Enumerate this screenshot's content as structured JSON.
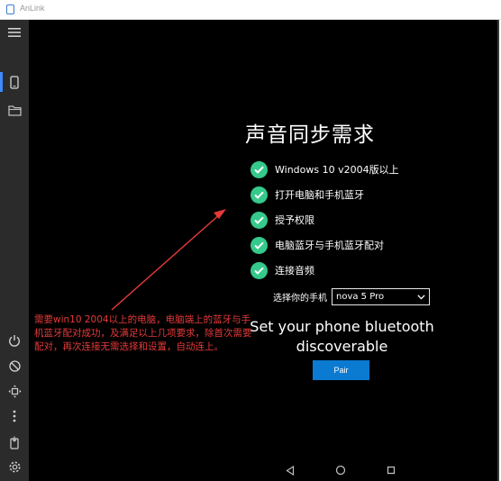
{
  "window": {
    "title": "AnLink"
  },
  "sidebar": {
    "top_items": [
      {
        "icon": "hamburger-menu-icon"
      },
      {
        "icon": "phone-icon"
      },
      {
        "icon": "folder-icon"
      }
    ],
    "bottom_items": [
      {
        "icon": "power-icon"
      },
      {
        "icon": "rotate-icon"
      },
      {
        "icon": "fit-screen-icon"
      },
      {
        "icon": "more-vertical-icon"
      },
      {
        "icon": "screenshot-icon"
      },
      {
        "icon": "settings-icon"
      }
    ],
    "active_color": "#3d8bfd"
  },
  "main": {
    "heading": "声音同步需求",
    "requirements": [
      "Windows 10 v2004版以上",
      "打开电脑和手机蓝牙",
      "授予权限",
      "电脑蓝牙与手机蓝牙配对",
      "连接音频"
    ],
    "select_label": "选择你的手机",
    "selected_phone": "nova 5 Pro",
    "bt_message": "Set your phone bluetooth discoverable",
    "pair_label": "Pair",
    "check_color": "#35c98b",
    "pair_color": "#0b7ad1"
  },
  "annotation": {
    "text": "需要win10 2004以上的电脑，电脑端上的蓝牙与手机蓝牙配对成功，及满足以上几项要求，除首次需要配对，再次连接无需选择和设置，自动连上。",
    "color": "#e63a3a"
  },
  "navbar": {
    "items": [
      {
        "icon": "back-triangle-icon"
      },
      {
        "icon": "home-circle-icon"
      },
      {
        "icon": "recents-square-icon"
      }
    ]
  }
}
